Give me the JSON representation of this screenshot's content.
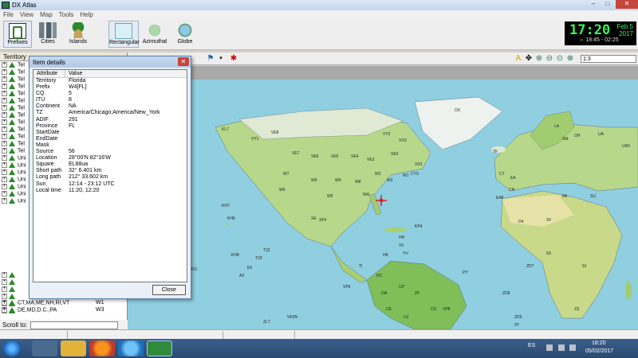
{
  "window": {
    "title": "DX Atlas"
  },
  "menu": [
    "File",
    "View",
    "Map",
    "Tools",
    "Help"
  ],
  "toolbar": {
    "buttons": [
      {
        "label": "Prefixes",
        "icon": "prefixes-icon"
      },
      {
        "label": "Cities",
        "icon": "cities-icon"
      },
      {
        "label": "Islands",
        "icon": "islands-icon"
      },
      {
        "label": "Rectangular",
        "icon": "rectangular-map-icon"
      },
      {
        "label": "Azimuthal",
        "icon": "azimuthal-map-icon"
      },
      {
        "label": "Globe",
        "icon": "globe-icon"
      }
    ]
  },
  "clock": {
    "time": "17:20",
    "date1": "Feb 5",
    "date2": "2017",
    "sun": "☼ 18:45 - 02:25"
  },
  "left_panel": {
    "header": "Territory",
    "rows_top": [
      "Tel",
      "Tel",
      "Tel",
      "Tel",
      "Tel",
      "Tel",
      "Tel",
      "Tel",
      "Tel",
      "Tel",
      "Tel",
      "Tel",
      "Tel",
      "Uni",
      "Uni",
      "Uni",
      "Uni",
      "Uni",
      "Uni",
      "Uni"
    ],
    "rows_bottom": [
      {
        "name": "CT,MA,ME,NH,RI,VT",
        "zone": "W1"
      },
      {
        "name": "DE,MD,D.C.,PA",
        "zone": "W3"
      }
    ],
    "scroll_label": "Scroll to:"
  },
  "map_toolbar": {
    "zoom": "1:3"
  },
  "dialog": {
    "title": "Item details",
    "col_attribute": "Attribute",
    "col_value": "Value",
    "rows": [
      {
        "k": "Territory",
        "v": "Florida"
      },
      {
        "k": "Prefix",
        "v": "W4[FL]"
      },
      {
        "k": "CQ",
        "v": "5"
      },
      {
        "k": "ITU",
        "v": "8"
      },
      {
        "k": "Continent",
        "v": "NA"
      },
      {
        "k": "TZ",
        "v": "America/Chicago;America/New_York"
      },
      {
        "k": "ADIF",
        "v": "291"
      },
      {
        "k": "Province",
        "v": "FL"
      },
      {
        "k": "StartDate",
        "v": ""
      },
      {
        "k": "EndDate",
        "v": ""
      },
      {
        "k": "Mask",
        "v": ""
      },
      {
        "k": "Source",
        "v": "56"
      },
      {
        "k": "Location",
        "v": "28°00'N  82°16'W"
      },
      {
        "k": "Square",
        "v": "EL88ua"
      },
      {
        "k": "Short path",
        "v": "32°  6.401 km"
      },
      {
        "k": "Long path",
        "v": "212°  33.602 km"
      },
      {
        "k": "Sun",
        "v": "12:14 - 23:12 UTC"
      },
      {
        "k": "Local time",
        "v": "11:20, 12:20"
      }
    ],
    "close_label": "Close"
  },
  "map_labels": [
    "KL7",
    "VE8",
    "VY1",
    "VE7",
    "VE6",
    "VE5",
    "VE4",
    "VE3",
    "VE2",
    "VO2",
    "VO1",
    "VY2",
    "CY9",
    "W7",
    "W0",
    "W9",
    "W8",
    "W4",
    "W5",
    "W6",
    "W2",
    "W3",
    "W1",
    "XE",
    "XF4",
    "TI",
    "HK",
    "HC",
    "YV",
    "PY",
    "OA",
    "CE",
    "LU",
    "CX",
    "ZP",
    "CP",
    "OX",
    "TF",
    "LA",
    "SM",
    "OH",
    "UA",
    "UA9",
    "EA",
    "CT",
    "CN",
    "EA8",
    "D4",
    "3V",
    "5A",
    "SU",
    "ZS",
    "ZD7",
    "ZD8",
    "ZD9",
    "VP8",
    "KH6",
    "KH7",
    "KH8",
    "T32",
    "T33",
    "FO",
    "VP6",
    "ZL7",
    "3Y",
    "VK9N",
    "A3",
    "E5",
    "HH",
    "KP4",
    "V5",
    "5X",
    "9J"
  ],
  "taskbar": {
    "lang": "ES",
    "time": "18:20",
    "date": "05/02/2017"
  }
}
